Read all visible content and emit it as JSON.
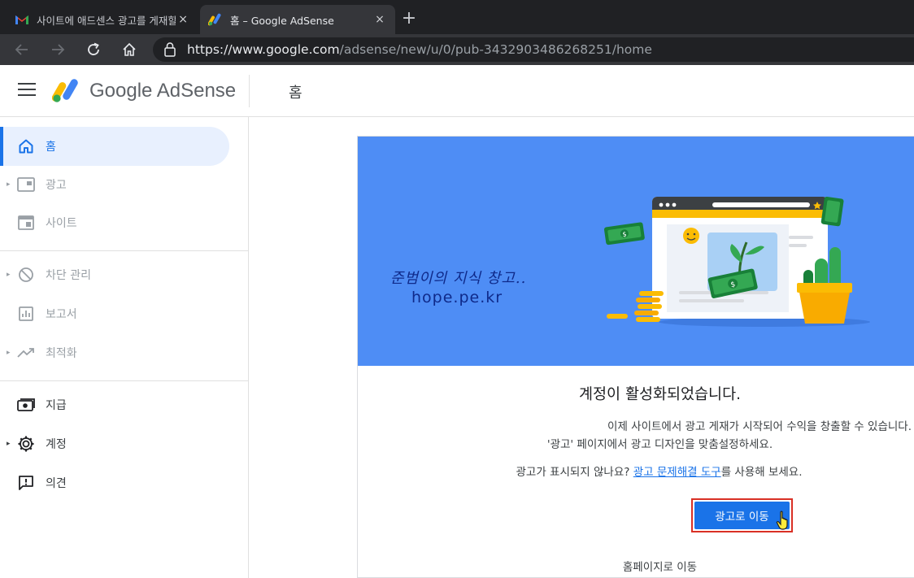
{
  "browser": {
    "tabs": [
      {
        "title": "사이트에 애드센스 광고를 게재할",
        "close": "×"
      },
      {
        "title": "홈 – Google AdSense",
        "close": "×"
      }
    ],
    "new_tab": "+",
    "url_host": "https://www.google.com",
    "url_path": "/adsense/new/u/0/pub-3432903486268251/home"
  },
  "header": {
    "brand": "Google AdSense",
    "page_title": "홈"
  },
  "sidebar": {
    "items": [
      {
        "label": "홈",
        "icon": "home-icon"
      },
      {
        "label": "광고",
        "icon": "ads-icon"
      },
      {
        "label": "사이트",
        "icon": "sites-icon"
      },
      {
        "label": "차단 관리",
        "icon": "block-icon"
      },
      {
        "label": "보고서",
        "icon": "reports-icon"
      },
      {
        "label": "최적화",
        "icon": "optimize-icon"
      },
      {
        "label": "지급",
        "icon": "payments-icon"
      },
      {
        "label": "계정",
        "icon": "settings-icon"
      },
      {
        "label": "의견",
        "icon": "feedback-icon"
      }
    ]
  },
  "main": {
    "watermark_line1": "준범이의 지식 창고..",
    "watermark_line2": "hope.pe.kr",
    "headline": "계정이 활성화되었습니다.",
    "body_line1": "이제 사이트에서 광고 게재가 시작되어 수익을 창출할 수 있습니다.",
    "body_line2": "'광고' 페이지에서 광고 디자인을 맞춤설정하세요.",
    "help_prefix": "광고가 표시되지 않나요? ",
    "help_link": "광고 문제해결 도구",
    "help_suffix": "를 사용해 보세요.",
    "cta_label": "광고로 이동",
    "home_link": "홈페이지로 이동"
  },
  "colors": {
    "accent": "#1a73e8",
    "banner": "#4e8df5",
    "highlight_border": "#d93025"
  }
}
